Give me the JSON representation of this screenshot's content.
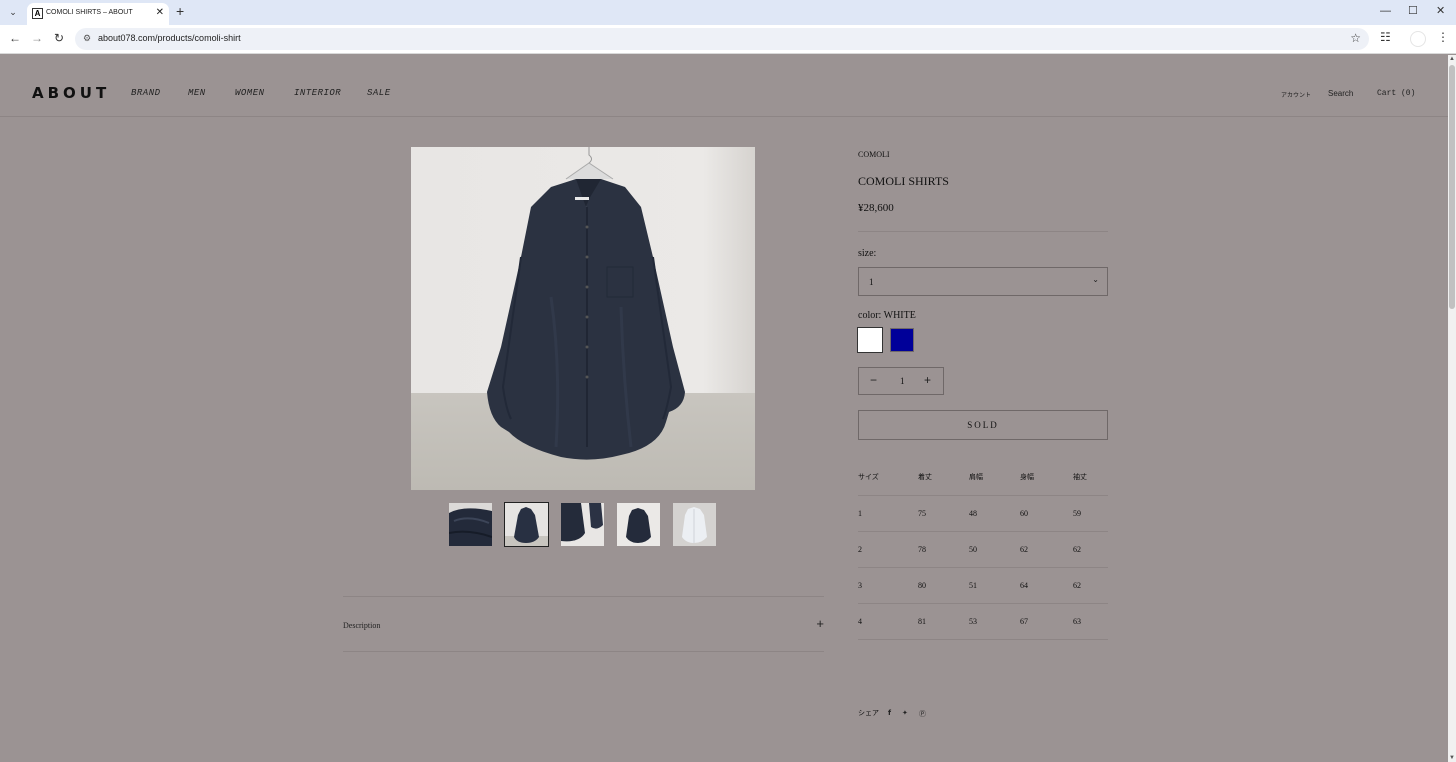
{
  "browser": {
    "tab_title": "COMOLI SHIRTS – ABOUT",
    "favicon_letter": "A",
    "url": "about078.com/products/comoli-shirt"
  },
  "header": {
    "logo": "ABOUT",
    "nav": [
      "BRAND",
      "MEN",
      "WOMEN",
      "INTERIOR",
      "SALE"
    ],
    "account": "アカウント",
    "search": "Search",
    "cart": "Cart (0)"
  },
  "gallery": {
    "active_thumbnail": 2,
    "thumbnail_count": 5
  },
  "description": {
    "label": "Description"
  },
  "product": {
    "vendor": "COMOLI",
    "title": "COMOLI SHIRTS",
    "price": "¥28,600",
    "size_label": "size:",
    "size_value": "1",
    "color_label": "color: WHITE",
    "swatches": [
      {
        "name": "WHITE",
        "color": "#ffffff",
        "selected": true
      },
      {
        "name": "NAVY",
        "color": "#000099",
        "selected": false
      }
    ],
    "quantity": "1",
    "sold_label": "SOLD"
  },
  "size_chart": {
    "headers": [
      "サイズ",
      "着丈",
      "肩幅",
      "身幅",
      "袖丈"
    ],
    "rows": [
      [
        "1",
        "75",
        "48",
        "60",
        "59"
      ],
      [
        "2",
        "78",
        "50",
        "62",
        "62"
      ],
      [
        "3",
        "80",
        "51",
        "64",
        "62"
      ],
      [
        "4",
        "81",
        "53",
        "67",
        "63"
      ]
    ]
  },
  "share": {
    "label": "シェア",
    "icons": [
      "facebook-icon",
      "twitter-icon",
      "pinterest-icon"
    ]
  }
}
